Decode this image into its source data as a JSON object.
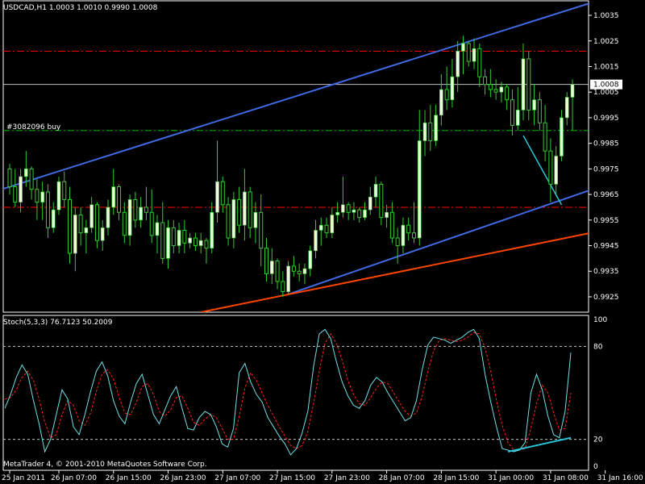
{
  "main_panel": {
    "header": "USDCAD,H1  1.0003 1.0010 0.9990 1.0008",
    "order_label": "#3082096 buy",
    "current_price_label": "1.0008",
    "y_ticks": [
      "1.0035",
      "1.0025",
      "1.0015",
      "1.0005",
      "0.9995",
      "0.9985",
      "0.9975",
      "0.9965",
      "0.9955",
      "0.9945",
      "0.9935",
      "0.9925"
    ]
  },
  "sub_panel": {
    "header": "Stoch(5,3,3) 76.7123 50.2009",
    "y_ticks": [
      "100",
      "80",
      "20",
      "0"
    ],
    "copyright": "MetaTrader 4, © 2001-2010 MetaQuotes Software Corp."
  },
  "x_ticks": [
    "25 Jan 2011",
    "26 Jan 07:00",
    "26 Jan 15:00",
    "26 Jan 23:00",
    "27 Jan 07:00",
    "27 Jan 15:00",
    "27 Jan 23:00",
    "28 Jan 07:00",
    "28 Jan 15:00",
    "31 Jan 00:00",
    "31 Jan 08:00",
    "31 Jan 16:00"
  ],
  "colors": {
    "background": "#000000",
    "grid_text": "#ffffff",
    "bull_candle": "#e8ffd8",
    "candle_wick": "#32cd32",
    "channel": "#4169e1",
    "red_trend": "#ff4500",
    "red_levels": "#ff0000",
    "order_level": "#00c000",
    "stoch_main": "#6fe0e8",
    "stoch_signal": "#ff2020",
    "divergence": "#26c6da"
  },
  "chart_data": [
    {
      "type": "candlestick",
      "symbol": "USDCAD",
      "timeframe": "H1",
      "ohlc_header": {
        "open": 1.0003,
        "high": 1.001,
        "low": 0.999,
        "close": 1.0008
      },
      "ylim": [
        0.9919,
        1.0041
      ],
      "current_price": 1.0008,
      "horizontal_levels": {
        "red_dashdot": [
          1.0021,
          0.996
        ],
        "order_buy": 0.999
      },
      "trendlines_price": {
        "channel_upper": [
          [
            0,
            0.9968
          ],
          [
            108,
            1.0041
          ]
        ],
        "channel_lower": [
          [
            51,
            0.9926
          ],
          [
            108,
            0.9968
          ]
        ],
        "red_support": [
          [
            35,
            0.9919
          ],
          [
            111,
            0.9952
          ]
        ],
        "divergence": [
          [
            94,
            0.9988
          ],
          [
            101,
            0.9961
          ]
        ]
      },
      "x_tick_index": [
        0,
        9,
        19,
        29,
        39,
        49,
        59,
        69,
        79,
        89,
        99,
        109
      ],
      "candles": [
        [
          0.9975,
          0.9977,
          0.9965,
          0.9968
        ],
        [
          0.9968,
          0.9975,
          0.996,
          0.9962
        ],
        [
          0.9962,
          0.9975,
          0.9958,
          0.9972
        ],
        [
          0.9972,
          0.9982,
          0.9968,
          0.9975
        ],
        [
          0.9975,
          0.9976,
          0.9963,
          0.9967
        ],
        [
          0.9967,
          0.9971,
          0.9955,
          0.9962
        ],
        [
          0.9962,
          0.997,
          0.9955,
          0.9966
        ],
        [
          0.9966,
          0.9969,
          0.9948,
          0.9952
        ],
        [
          0.9952,
          0.9962,
          0.995,
          0.9959
        ],
        [
          0.9959,
          0.9972,
          0.9957,
          0.997
        ],
        [
          0.997,
          0.9974,
          0.996,
          0.9963
        ],
        [
          0.9963,
          0.9968,
          0.9938,
          0.9942
        ],
        [
          0.9942,
          0.996,
          0.9935,
          0.9957
        ],
        [
          0.9957,
          0.996,
          0.9945,
          0.995
        ],
        [
          0.995,
          0.9955,
          0.9942,
          0.9952
        ],
        [
          0.9952,
          0.9964,
          0.995,
          0.9961
        ],
        [
          0.9961,
          0.9962,
          0.9944,
          0.9947
        ],
        [
          0.9947,
          0.9955,
          0.9943,
          0.9952
        ],
        [
          0.9952,
          0.9963,
          0.9949,
          0.996
        ],
        [
          0.996,
          0.9975,
          0.9957,
          0.9968
        ],
        [
          0.9968,
          0.9969,
          0.9955,
          0.9958
        ],
        [
          0.9958,
          0.9962,
          0.9946,
          0.9949
        ],
        [
          0.9949,
          0.9965,
          0.9945,
          0.9963
        ],
        [
          0.9963,
          0.9966,
          0.9952,
          0.9955
        ],
        [
          0.9955,
          0.9964,
          0.9952,
          0.996
        ],
        [
          0.996,
          0.9968,
          0.9955,
          0.9958
        ],
        [
          0.9958,
          0.9967,
          0.9946,
          0.9949
        ],
        [
          0.9949,
          0.9957,
          0.9942,
          0.9954
        ],
        [
          0.9954,
          0.9962,
          0.9938,
          0.994
        ],
        [
          0.994,
          0.9955,
          0.9936,
          0.9952
        ],
        [
          0.9952,
          0.9955,
          0.9942,
          0.9945
        ],
        [
          0.9945,
          0.9954,
          0.9942,
          0.9951
        ],
        [
          0.9951,
          0.9955,
          0.9942,
          0.9946
        ],
        [
          0.9946,
          0.995,
          0.9944,
          0.9948
        ],
        [
          0.9948,
          0.995,
          0.9943,
          0.9945
        ],
        [
          0.9945,
          0.995,
          0.9942,
          0.9947
        ],
        [
          0.9947,
          0.9948,
          0.9938,
          0.9944
        ],
        [
          0.9944,
          0.9962,
          0.9942,
          0.9958
        ],
        [
          0.9958,
          0.9986,
          0.9954,
          0.997
        ],
        [
          0.997,
          0.9972,
          0.9958,
          0.9961
        ],
        [
          0.9961,
          0.9964,
          0.9945,
          0.9948
        ],
        [
          0.9948,
          0.9966,
          0.9944,
          0.9963
        ],
        [
          0.9963,
          0.9968,
          0.995,
          0.9953
        ],
        [
          0.9953,
          0.9975,
          0.9947,
          0.9966
        ],
        [
          0.9966,
          0.9968,
          0.9948,
          0.9952
        ],
        [
          0.9952,
          0.9962,
          0.9946,
          0.9958
        ],
        [
          0.9958,
          0.9965,
          0.9937,
          0.9944
        ],
        [
          0.9944,
          0.9948,
          0.9931,
          0.9934
        ],
        [
          0.9934,
          0.9944,
          0.993,
          0.9939
        ],
        [
          0.9939,
          0.994,
          0.9928,
          0.9931
        ],
        [
          0.9931,
          0.9935,
          0.9925,
          0.9927
        ],
        [
          0.9927,
          0.9939,
          0.9926,
          0.9937
        ],
        [
          0.9937,
          0.9941,
          0.9933,
          0.9935
        ],
        [
          0.9935,
          0.9938,
          0.9931,
          0.9934
        ],
        [
          0.9934,
          0.9938,
          0.993,
          0.9936
        ],
        [
          0.9936,
          0.9945,
          0.9933,
          0.9943
        ],
        [
          0.9943,
          0.9955,
          0.994,
          0.9951
        ],
        [
          0.9951,
          0.9956,
          0.9945,
          0.9953
        ],
        [
          0.9953,
          0.9956,
          0.9948,
          0.995
        ],
        [
          0.995,
          0.996,
          0.9948,
          0.9957
        ],
        [
          0.9957,
          0.9962,
          0.9954,
          0.9958
        ],
        [
          0.9958,
          0.9972,
          0.9956,
          0.9961
        ],
        [
          0.9961,
          0.9962,
          0.9955,
          0.9958
        ],
        [
          0.9958,
          0.9962,
          0.9955,
          0.9959
        ],
        [
          0.9959,
          0.996,
          0.9954,
          0.9956
        ],
        [
          0.9956,
          0.9962,
          0.9955,
          0.9959
        ],
        [
          0.9959,
          0.9968,
          0.9957,
          0.9964
        ],
        [
          0.9964,
          0.9972,
          0.996,
          0.9969
        ],
        [
          0.9969,
          0.997,
          0.9953,
          0.9956
        ],
        [
          0.9956,
          0.9961,
          0.9952,
          0.9958
        ],
        [
          0.9958,
          0.9962,
          0.9946,
          0.9948
        ],
        [
          0.9948,
          0.9952,
          0.9938,
          0.9945
        ],
        [
          0.9945,
          0.9956,
          0.9942,
          0.9953
        ],
        [
          0.9953,
          0.9956,
          0.9947,
          0.995
        ],
        [
          0.995,
          0.9962,
          0.9946,
          0.9948
        ],
        [
          0.9948,
          0.9998,
          0.9945,
          0.9986
        ],
        [
          0.9986,
          0.9998,
          0.998,
          0.9993
        ],
        [
          0.9993,
          1.0,
          0.9982,
          0.9986
        ],
        [
          0.9986,
          1.0,
          0.9984,
          0.9996
        ],
        [
          0.9996,
          1.0012,
          0.9992,
          1.0006
        ],
        [
          1.0006,
          1.0015,
          0.9998,
          1.0002
        ],
        [
          1.0002,
          1.0018,
          0.9999,
          1.0011
        ],
        [
          1.0011,
          1.0025,
          1.0005,
          1.0021
        ],
        [
          1.0021,
          1.0027,
          1.0012,
          1.0024
        ],
        [
          1.0024,
          1.0025,
          1.0015,
          1.0017
        ],
        [
          1.0017,
          1.0026,
          1.0014,
          1.0022
        ],
        [
          1.0022,
          1.0024,
          1.0007,
          1.0011
        ],
        [
          1.0011,
          1.0014,
          1.0004,
          1.0008
        ],
        [
          1.0008,
          1.0014,
          1.0003,
          1.0006
        ],
        [
          1.0006,
          1.001,
          1.0002,
          1.0005
        ],
        [
          1.0005,
          1.0009,
          1.0001,
          1.0007
        ],
        [
          1.0007,
          1.0008,
          0.9998,
          1.0002
        ],
        [
          1.0002,
          1.0006,
          0.9988,
          0.9992
        ],
        [
          0.9992,
          1.0007,
          0.999,
          0.9998
        ],
        [
          0.9998,
          1.0024,
          0.9994,
          1.0018
        ],
        [
          1.0018,
          1.0021,
          0.9994,
          0.9998
        ],
        [
          0.9998,
          1.0008,
          0.9992,
          1.0002
        ],
        [
          1.0002,
          1.0005,
          0.999,
          0.9993
        ],
        [
          0.9993,
          1.0,
          0.9978,
          0.9982
        ],
        [
          0.9982,
          0.9987,
          0.9962,
          0.9969
        ],
        [
          0.9969,
          0.9984,
          0.9965,
          0.998
        ],
        [
          0.998,
          0.9998,
          0.9978,
          0.9995
        ],
        [
          0.9995,
          1.0005,
          0.9992,
          1.0003
        ],
        [
          1.0003,
          1.001,
          0.999,
          1.0008
        ]
      ]
    },
    {
      "type": "line",
      "title": "Stoch(5,3,3) 76.7123 50.2009",
      "ylim": [
        0,
        100
      ],
      "levels": [
        80,
        20
      ],
      "series": [
        {
          "values": [
            40,
            49,
            60,
            68,
            62,
            45,
            30,
            12,
            20,
            36,
            52,
            46,
            28,
            23,
            36,
            51,
            64,
            70,
            61,
            45,
            35,
            30,
            44,
            56,
            62,
            49,
            36,
            30,
            39,
            48,
            54,
            40,
            27,
            26,
            34,
            38,
            36,
            28,
            17,
            15,
            27,
            63,
            69,
            57,
            49,
            44,
            34,
            28,
            22,
            17,
            10,
            14,
            24,
            38,
            67,
            88,
            91,
            85,
            70,
            57,
            48,
            42,
            40,
            45,
            55,
            60,
            57,
            50,
            44,
            38,
            32,
            34,
            45,
            65,
            81,
            86,
            85,
            84,
            82,
            84,
            86,
            89,
            91,
            85,
            62,
            44,
            28,
            14,
            13,
            12,
            13,
            18,
            50,
            62,
            52,
            35,
            23,
            21,
            38,
            76
          ]
        },
        {
          "values": [
            46,
            47,
            52,
            60,
            64,
            58,
            46,
            31,
            21,
            23,
            36,
            45,
            42,
            32,
            29,
            37,
            51,
            62,
            65,
            59,
            47,
            37,
            36,
            44,
            54,
            56,
            49,
            38,
            35,
            39,
            47,
            48,
            40,
            31,
            29,
            33,
            36,
            34,
            27,
            20,
            20,
            35,
            53,
            63,
            58,
            50,
            42,
            35,
            28,
            22,
            16,
            14,
            16,
            25,
            43,
            64,
            82,
            88,
            82,
            71,
            58,
            49,
            43,
            42,
            47,
            53,
            57,
            56,
            50,
            44,
            38,
            35,
            37,
            48,
            64,
            77,
            84,
            85,
            84,
            83,
            84,
            86,
            89,
            88,
            79,
            64,
            45,
            29,
            18,
            13,
            13,
            14,
            27,
            43,
            55,
            50,
            37,
            26,
            27,
            50
          ]
        }
      ],
      "divergence_line": [
        [
          88,
          12
        ],
        [
          99,
          21
        ]
      ]
    }
  ]
}
